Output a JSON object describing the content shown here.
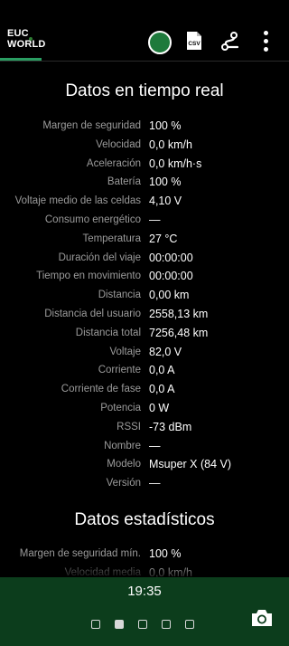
{
  "app": {
    "logo_line1": "EUC",
    "logo_line2": "WORLD"
  },
  "toolbar": {
    "csv_label": "CSV",
    "icons": [
      "connection-status-icon",
      "csv-export-icon",
      "route-icon",
      "more-vert-icon"
    ],
    "accent_color": "#2a9d62",
    "status_color": "#1e7a3c"
  },
  "realtime": {
    "title": "Datos en tiempo real",
    "rows": [
      {
        "label": "Margen de seguridad",
        "value": "100 %"
      },
      {
        "label": "Velocidad",
        "value": "0,0 km/h"
      },
      {
        "label": "Aceleración",
        "value": "0,0 km/h·s"
      },
      {
        "label": "Batería",
        "value": "100 %"
      },
      {
        "label": "Voltaje medio de las celdas",
        "value": "4,10 V"
      },
      {
        "label": "Consumo energético",
        "value": "—"
      },
      {
        "label": "Temperatura",
        "value": "27 °C"
      },
      {
        "label": "Duración del viaje",
        "value": "00:00:00"
      },
      {
        "label": "Tiempo en movimiento",
        "value": "00:00:00"
      },
      {
        "label": "Distancia",
        "value": "0,00 km"
      },
      {
        "label": "Distancia del usuario",
        "value": "2558,13 km"
      },
      {
        "label": "Distancia total",
        "value": "7256,48 km"
      },
      {
        "label": "Voltaje",
        "value": "82,0 V"
      },
      {
        "label": "Corriente",
        "value": "0,0 A"
      },
      {
        "label": "Corriente de fase",
        "value": "0,0 A"
      },
      {
        "label": "Potencia",
        "value": "0 W"
      },
      {
        "label": "RSSI",
        "value": "-73 dBm"
      },
      {
        "label": "Nombre",
        "value": "—"
      },
      {
        "label": "Modelo",
        "value": "Msuper X (84 V)"
      },
      {
        "label": "Versión",
        "value": "—"
      }
    ]
  },
  "stats": {
    "title": "Datos estadísticos",
    "rows": [
      {
        "label": "Margen de seguridad mín.",
        "value": "100 %"
      },
      {
        "label": "Velocidad media",
        "value": "0,0 km/h"
      }
    ]
  },
  "bottom_bar": {
    "time": "19:35",
    "pages": 5,
    "active_page": 2,
    "background": "#0c3d1c"
  }
}
